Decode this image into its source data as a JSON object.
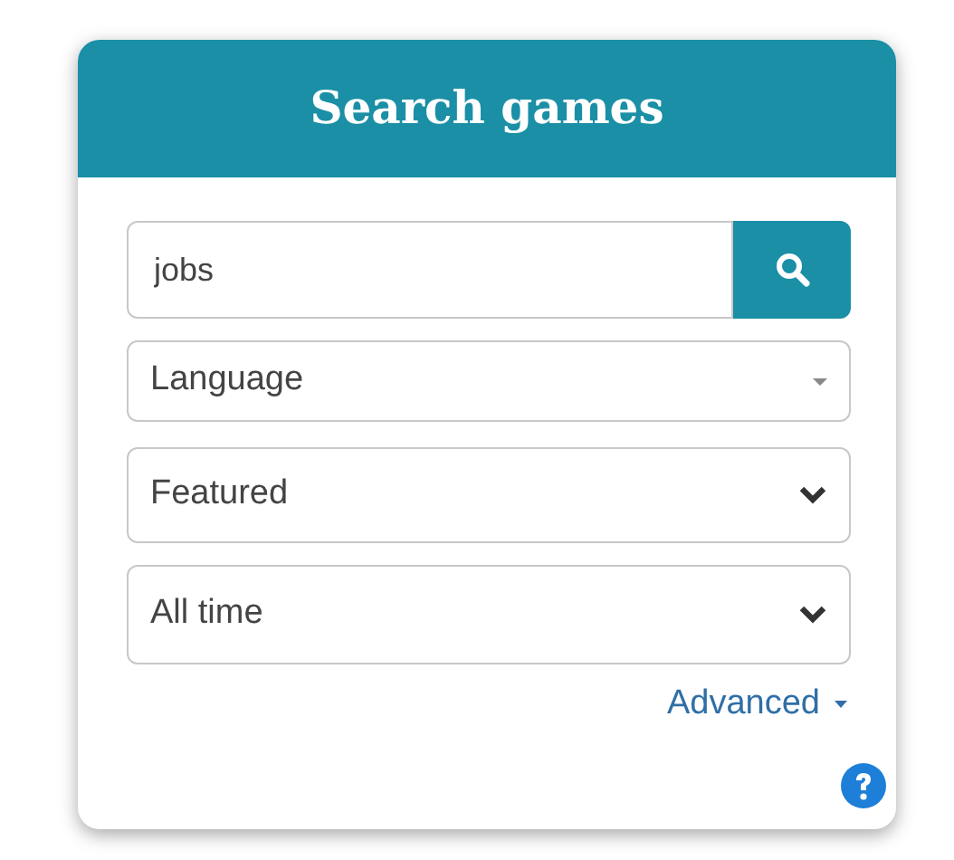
{
  "panel": {
    "title": "Search games"
  },
  "search": {
    "value": "jobs"
  },
  "dropdowns": [
    {
      "label": "Language",
      "kind": "caret"
    },
    {
      "label": "Featured",
      "kind": "chevron"
    },
    {
      "label": "All time",
      "kind": "chevron"
    }
  ],
  "advanced_link": {
    "label": "Advanced",
    "expanded": false
  }
}
